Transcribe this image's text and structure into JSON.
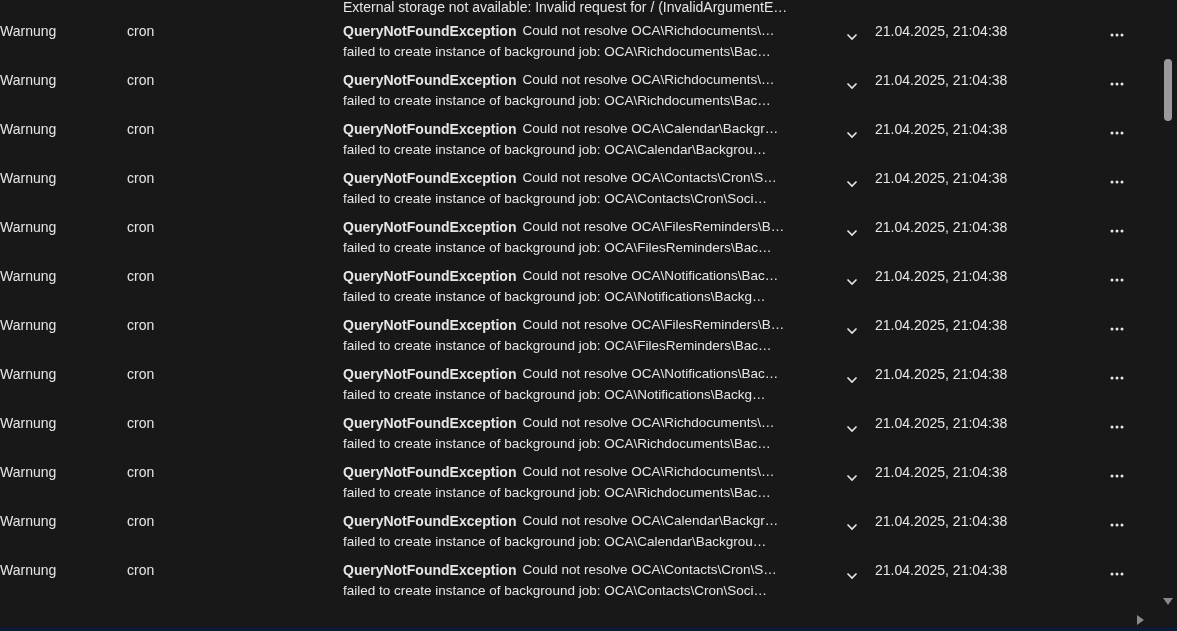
{
  "partial_row": {
    "detail": "External storage not available: Invalid request for / (InvalidArgumentE…"
  },
  "rows": [
    {
      "level": "Warnung",
      "app": "cron",
      "exception": "QueryNotFoundException",
      "message": "Could not resolve OCA\\Richdocuments\\…",
      "detail": "failed to create instance of background job: OCA\\Richdocuments\\Bac…",
      "time": "21.04.2025, 21:04:38"
    },
    {
      "level": "Warnung",
      "app": "cron",
      "exception": "QueryNotFoundException",
      "message": "Could not resolve OCA\\Richdocuments\\…",
      "detail": "failed to create instance of background job: OCA\\Richdocuments\\Bac…",
      "time": "21.04.2025, 21:04:38"
    },
    {
      "level": "Warnung",
      "app": "cron",
      "exception": "QueryNotFoundException",
      "message": "Could not resolve OCA\\Calendar\\Backgr…",
      "detail": "failed to create instance of background job: OCA\\Calendar\\Backgrou…",
      "time": "21.04.2025, 21:04:38"
    },
    {
      "level": "Warnung",
      "app": "cron",
      "exception": "QueryNotFoundException",
      "message": "Could not resolve OCA\\Contacts\\Cron\\S…",
      "detail": "failed to create instance of background job: OCA\\Contacts\\Cron\\Soci…",
      "time": "21.04.2025, 21:04:38"
    },
    {
      "level": "Warnung",
      "app": "cron",
      "exception": "QueryNotFoundException",
      "message": "Could not resolve OCA\\FilesReminders\\B…",
      "detail": "failed to create instance of background job: OCA\\FilesReminders\\Bac…",
      "time": "21.04.2025, 21:04:38"
    },
    {
      "level": "Warnung",
      "app": "cron",
      "exception": "QueryNotFoundException",
      "message": "Could not resolve OCA\\Notifications\\Bac…",
      "detail": "failed to create instance of background job: OCA\\Notifications\\Backg…",
      "time": "21.04.2025, 21:04:38"
    },
    {
      "level": "Warnung",
      "app": "cron",
      "exception": "QueryNotFoundException",
      "message": "Could not resolve OCA\\FilesReminders\\B…",
      "detail": "failed to create instance of background job: OCA\\FilesReminders\\Bac…",
      "time": "21.04.2025, 21:04:38"
    },
    {
      "level": "Warnung",
      "app": "cron",
      "exception": "QueryNotFoundException",
      "message": "Could not resolve OCA\\Notifications\\Bac…",
      "detail": "failed to create instance of background job: OCA\\Notifications\\Backg…",
      "time": "21.04.2025, 21:04:38"
    },
    {
      "level": "Warnung",
      "app": "cron",
      "exception": "QueryNotFoundException",
      "message": "Could not resolve OCA\\Richdocuments\\…",
      "detail": "failed to create instance of background job: OCA\\Richdocuments\\Bac…",
      "time": "21.04.2025, 21:04:38"
    },
    {
      "level": "Warnung",
      "app": "cron",
      "exception": "QueryNotFoundException",
      "message": "Could not resolve OCA\\Richdocuments\\…",
      "detail": "failed to create instance of background job: OCA\\Richdocuments\\Bac…",
      "time": "21.04.2025, 21:04:38"
    },
    {
      "level": "Warnung",
      "app": "cron",
      "exception": "QueryNotFoundException",
      "message": "Could not resolve OCA\\Calendar\\Backgr…",
      "detail": "failed to create instance of background job: OCA\\Calendar\\Backgrou…",
      "time": "21.04.2025, 21:04:38"
    },
    {
      "level": "Warnung",
      "app": "cron",
      "exception": "QueryNotFoundException",
      "message": "Could not resolve OCA\\Contacts\\Cron\\S…",
      "detail": "failed to create instance of background job: OCA\\Contacts\\Cron\\Soci…",
      "time": "21.04.2025, 21:04:38"
    }
  ]
}
